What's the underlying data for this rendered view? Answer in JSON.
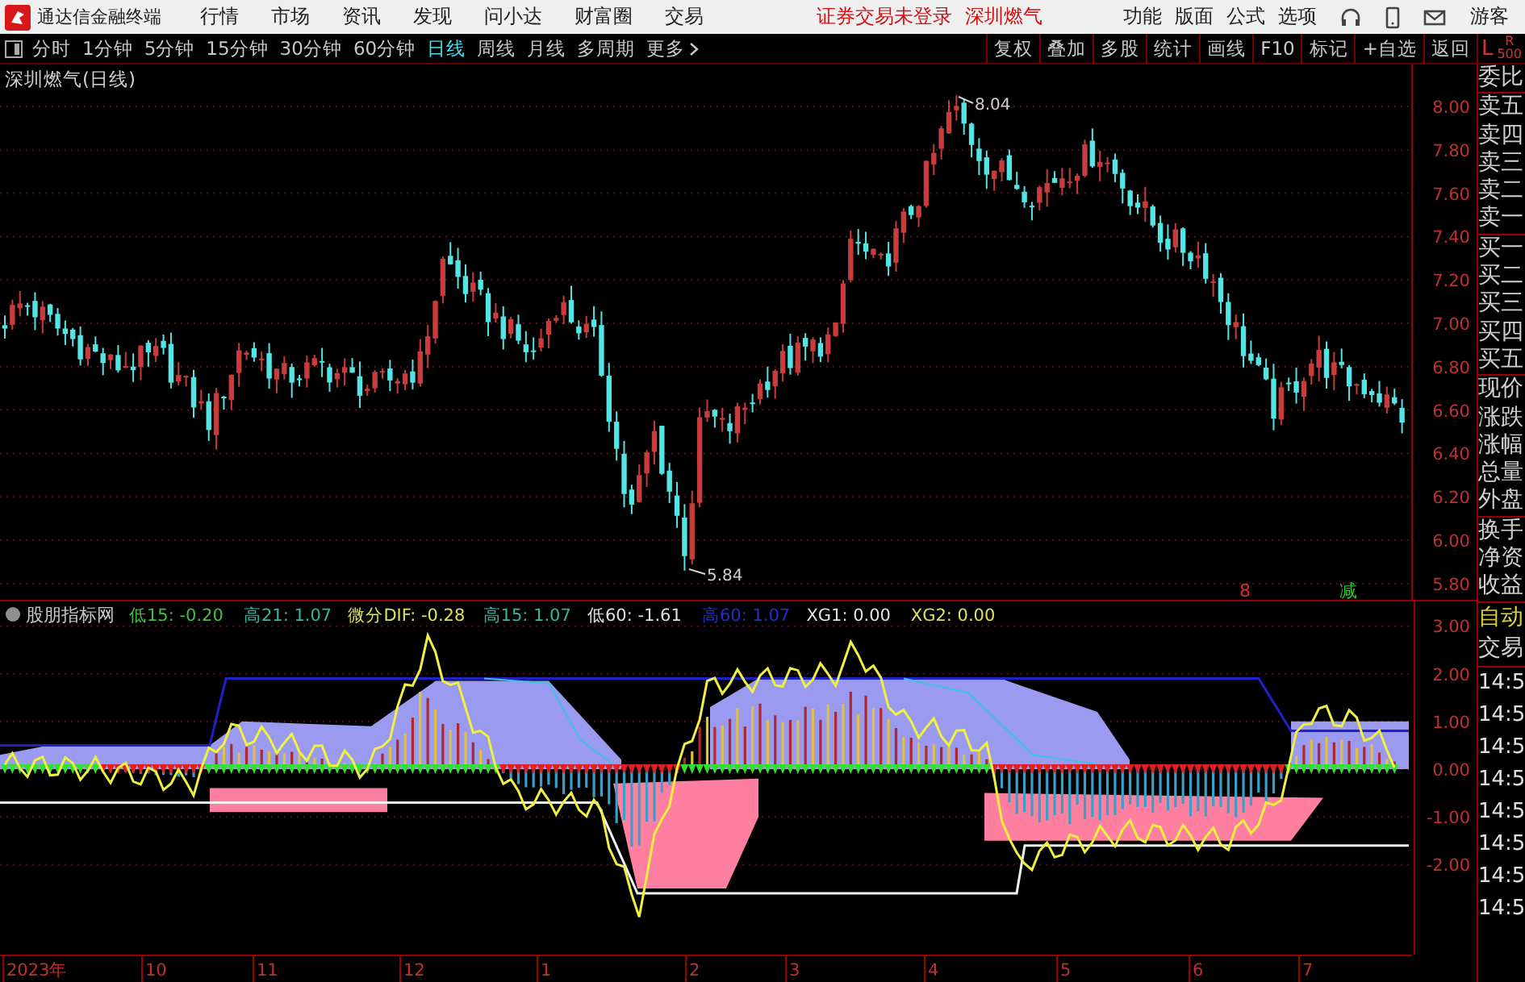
{
  "menu_bar": {
    "app_title": "通达信金融终端",
    "menus": [
      "行情",
      "市场",
      "资讯",
      "发现",
      "问小达",
      "财富圈",
      "交易"
    ],
    "notice": "证券交易未登录",
    "stock": "深圳燃气",
    "right_menus": [
      "功能",
      "版面",
      "公式",
      "选项"
    ],
    "user": "游客"
  },
  "period_bar": {
    "periods": [
      {
        "label": "分时",
        "selected": false
      },
      {
        "label": "1分钟",
        "selected": false
      },
      {
        "label": "5分钟",
        "selected": false
      },
      {
        "label": "15分钟",
        "selected": false
      },
      {
        "label": "30分钟",
        "selected": false
      },
      {
        "label": "60分钟",
        "selected": false
      },
      {
        "label": "日线",
        "selected": true
      },
      {
        "label": "周线",
        "selected": false
      },
      {
        "label": "月线",
        "selected": false
      },
      {
        "label": "多周期",
        "selected": false
      }
    ],
    "more": "更多",
    "tools": [
      "复权",
      "叠加",
      "多股",
      "统计",
      "画线",
      "F10",
      "标记",
      "+自选",
      "返回"
    ],
    "side_left": "L",
    "side_right": "R",
    "side_sub": "500"
  },
  "price_chart": {
    "title": "深圳燃气(日线)",
    "high_label": "8.04",
    "low_label": "5.84",
    "markers": [
      {
        "text": "8",
        "color": "#d03030"
      },
      {
        "text": "减",
        "color": "#30c030"
      }
    ],
    "y_labels": [
      "8.00",
      "7.80",
      "7.60",
      "7.40",
      "7.20",
      "7.00",
      "6.80",
      "6.60",
      "6.40",
      "6.20",
      "6.00",
      "5.80"
    ]
  },
  "indicator": {
    "name": "股朋指标网",
    "values": [
      {
        "text": "低15: -0.20",
        "color": "#40c040"
      },
      {
        "text": "高21: 1.07",
        "color": "#30b8a0"
      },
      {
        "text": "微分DIF: -0.28",
        "color": "#e0e060"
      },
      {
        "text": "高15: 1.07",
        "color": "#30b8a0"
      },
      {
        "text": "低60: -1.61",
        "color": "#e0e0e0"
      },
      {
        "text": "高60: 1.07",
        "color": "#2030c8"
      },
      {
        "text": "XG1: 0.00",
        "color": "#e0e0e0"
      },
      {
        "text": "XG2: 0.00",
        "color": "#e0e060"
      }
    ],
    "y_labels": [
      "3.00",
      "2.00",
      "1.00",
      "0.00",
      "-1.00",
      "-2.00"
    ]
  },
  "time_axis": [
    "2023年",
    "10",
    "11",
    "12",
    "1",
    "2",
    "3",
    "4",
    "5",
    "6",
    "7"
  ],
  "quote_panel": {
    "groups": [
      [
        {
          "text": "委比",
          "highlighted": false
        }
      ],
      [
        {
          "text": "卖五",
          "highlighted": false
        },
        {
          "text": "卖四",
          "highlighted": false
        },
        {
          "text": "卖三",
          "highlighted": false
        },
        {
          "text": "卖二",
          "highlighted": false
        },
        {
          "text": "卖一",
          "highlighted": false
        }
      ],
      [
        {
          "text": "买一",
          "highlighted": false
        },
        {
          "text": "买二",
          "highlighted": false
        },
        {
          "text": "买三",
          "highlighted": false
        },
        {
          "text": "买四",
          "highlighted": false
        },
        {
          "text": "买五",
          "highlighted": false
        }
      ],
      [
        {
          "text": "现价",
          "highlighted": false
        },
        {
          "text": "涨跌",
          "highlighted": false
        },
        {
          "text": "涨幅",
          "highlighted": false
        },
        {
          "text": "总量",
          "highlighted": false
        },
        {
          "text": "外盘",
          "highlighted": false
        }
      ],
      [
        {
          "text": "换手",
          "highlighted": false
        },
        {
          "text": "净资",
          "highlighted": false
        },
        {
          "text": "收益",
          "highlighted": false
        }
      ],
      [
        {
          "text": "自动",
          "highlighted": true
        },
        {
          "text": "交易",
          "highlighted": false
        }
      ]
    ],
    "times": [
      "14:5",
      "14:5",
      "14:5",
      "14:5",
      "14:5",
      "14:5",
      "14:5",
      "14:5"
    ]
  }
}
